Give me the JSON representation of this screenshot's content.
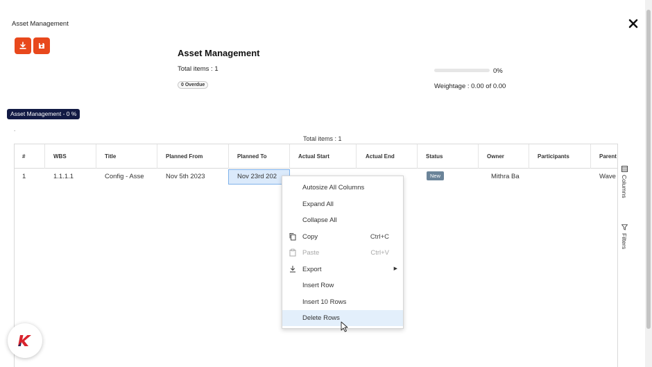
{
  "window": {
    "title": "Asset Management"
  },
  "summary": {
    "title": "Asset Management",
    "total_items": "Total items : 1",
    "overdue_badge": "0 Overdue",
    "progress_percent": 0,
    "progress_label": "0%",
    "weightage": "Weightage : 0.00 of 0.00"
  },
  "tag": {
    "label": "Asset Management - 0 %"
  },
  "dot": ".",
  "grid": {
    "total_items": "Total items : 1",
    "columns": [
      "#",
      "WBS",
      "Title",
      "Planned From",
      "Planned To",
      "Actual Start",
      "Actual End",
      "Status",
      "Owner",
      "Participants",
      "Parent"
    ],
    "rows": [
      {
        "index": "1",
        "wbs": "1.1.1.1",
        "title": "Config - Asse",
        "planned_from": "Nov 5th 2023",
        "planned_to": "Nov 23rd 202",
        "actual_start": "",
        "actual_end": "",
        "status": "New",
        "owner": "Mithra Ba",
        "participants": "",
        "parent": "Wave"
      }
    ]
  },
  "side_panel": {
    "columns_label": "Columns",
    "filters_label": "Filters"
  },
  "context_menu": {
    "items": [
      {
        "label": "Autosize All Columns",
        "shortcut": "",
        "icon": "",
        "disabled": false
      },
      {
        "label": "Expand All",
        "shortcut": "",
        "icon": "",
        "disabled": false
      },
      {
        "label": "Collapse All",
        "shortcut": "",
        "icon": "",
        "disabled": false
      },
      {
        "label": "Copy",
        "shortcut": "Ctrl+C",
        "icon": "copy-icon",
        "disabled": false
      },
      {
        "label": "Paste",
        "shortcut": "Ctrl+V",
        "icon": "paste-icon",
        "disabled": true
      },
      {
        "label": "Export",
        "shortcut": "",
        "icon": "export-icon",
        "disabled": false,
        "submenu": true
      },
      {
        "label": "Insert Row",
        "shortcut": "",
        "icon": "",
        "disabled": false
      },
      {
        "label": "Insert 10 Rows",
        "shortcut": "",
        "icon": "",
        "disabled": false
      },
      {
        "label": "Delete Rows",
        "shortcut": "",
        "icon": "",
        "disabled": false,
        "hovered": true
      }
    ]
  },
  "colors": {
    "accent": "#e8481c",
    "tag_bg": "#121a44",
    "status_new": "#6b8499",
    "selection": "#dbeafb",
    "logo_red": "#d9232d"
  },
  "icons": {
    "download": "download-icon",
    "save": "save-icon",
    "close": "close-icon",
    "logo": "k-logo-icon"
  }
}
